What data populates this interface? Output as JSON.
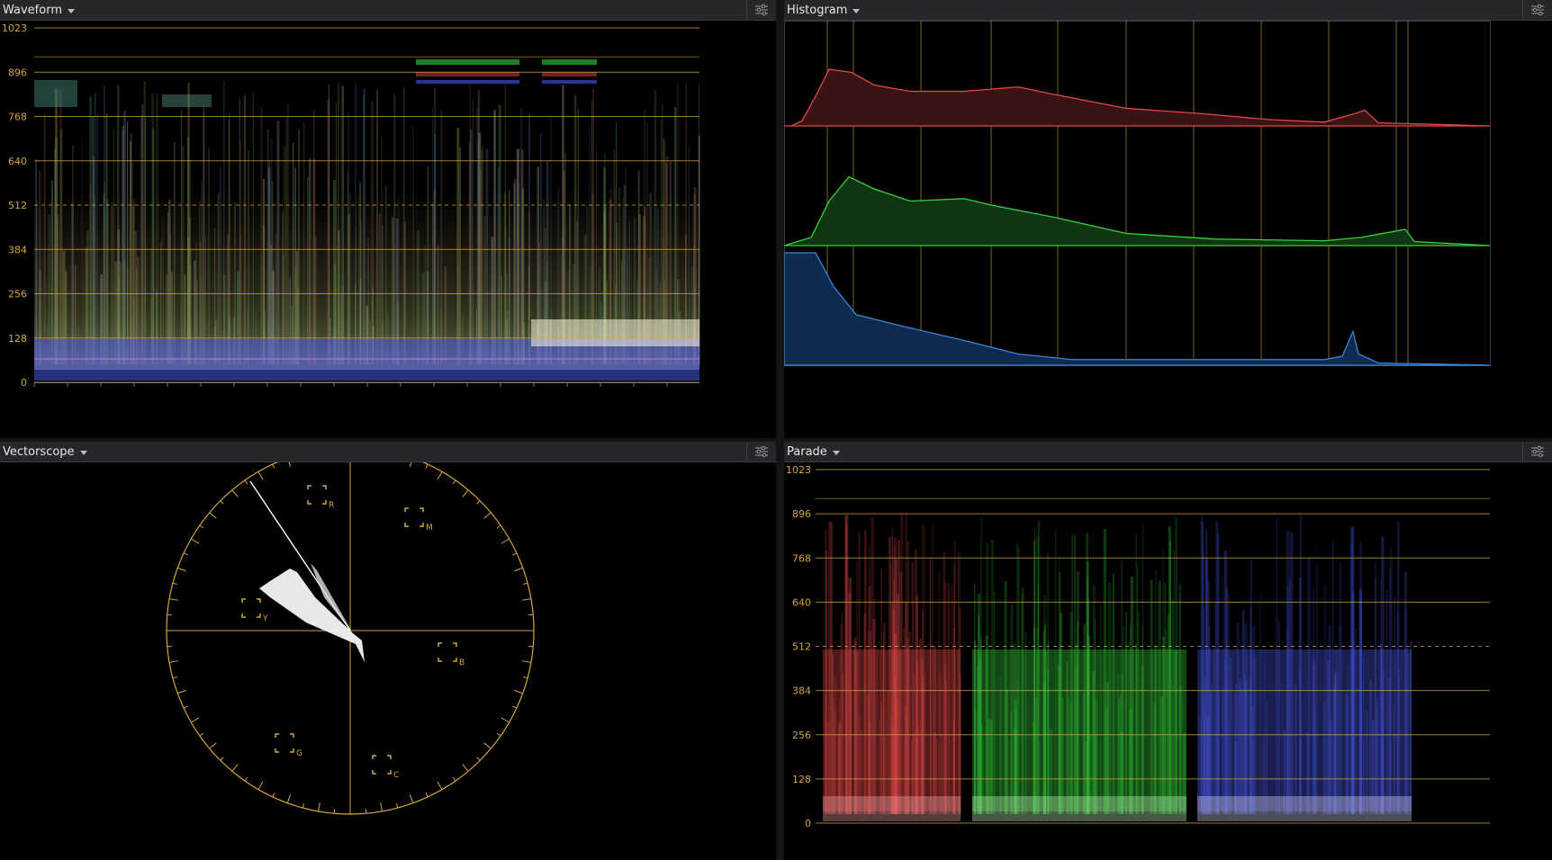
{
  "panels": {
    "waveform": {
      "title": "Waveform"
    },
    "histogram": {
      "title": "Histogram"
    },
    "vectorscope": {
      "title": "Vectorscope"
    },
    "parade": {
      "title": "Parade"
    }
  },
  "scale": {
    "ticks": [
      "1023",
      "896",
      "768",
      "640",
      "512",
      "384",
      "256",
      "128",
      "0"
    ]
  },
  "vectorscope": {
    "targets": [
      "R",
      "M",
      "Y",
      "B",
      "G",
      "C"
    ]
  },
  "colors": {
    "graticule": "#d4a63a",
    "red": "#e04848",
    "green": "#37d03c",
    "blue": "#4a58e8",
    "hist_red_fill": "#3a1414",
    "hist_green_fill": "#0f3512",
    "hist_blue_fill": "#0e2a4e"
  },
  "icons": {
    "settings": "sliders-icon",
    "dropdown": "chevron-down-icon"
  }
}
